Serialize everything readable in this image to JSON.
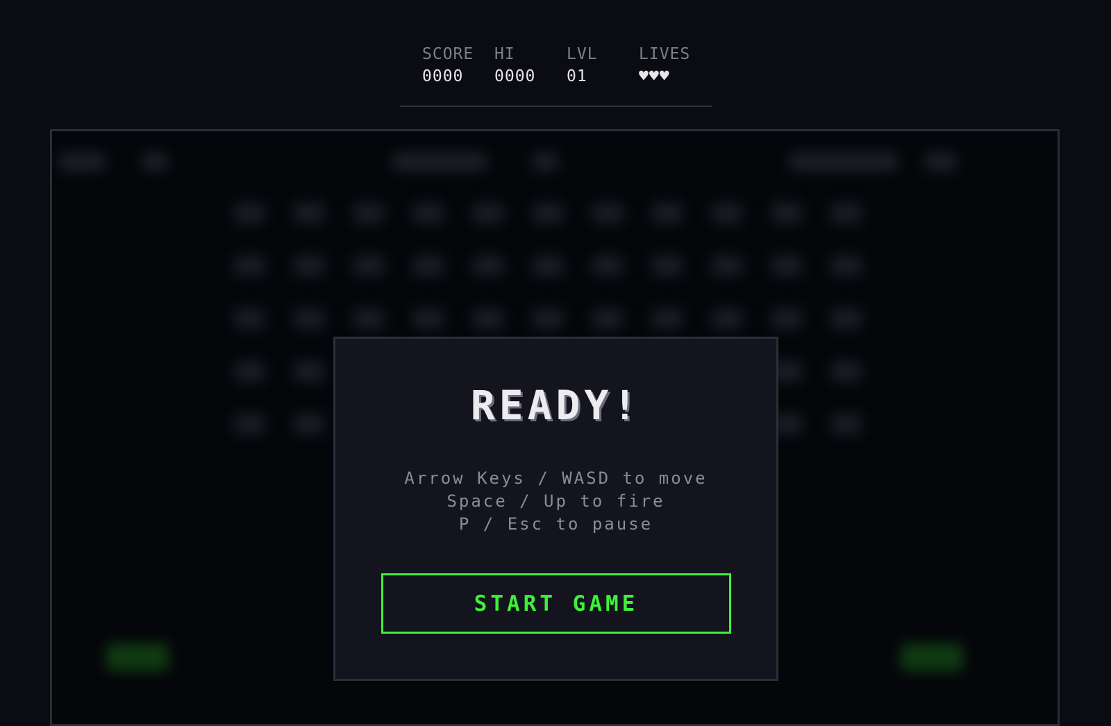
{
  "hud": {
    "score_label": "SCORE",
    "score_value": "0000",
    "hi_label": "HI",
    "hi_value": "0000",
    "level_label": "LVL",
    "level_value": "01",
    "lives_label": "LIVES",
    "lives_value": "♥♥♥"
  },
  "overlay": {
    "title": "READY!",
    "instructions": [
      "Arrow Keys / WASD to move",
      "Space / Up to fire",
      "P / Esc to pause"
    ],
    "start_label": "START GAME"
  },
  "colors": {
    "background": "#0b0c12",
    "accent_green": "#3ff03a",
    "panel": "#13141d"
  }
}
